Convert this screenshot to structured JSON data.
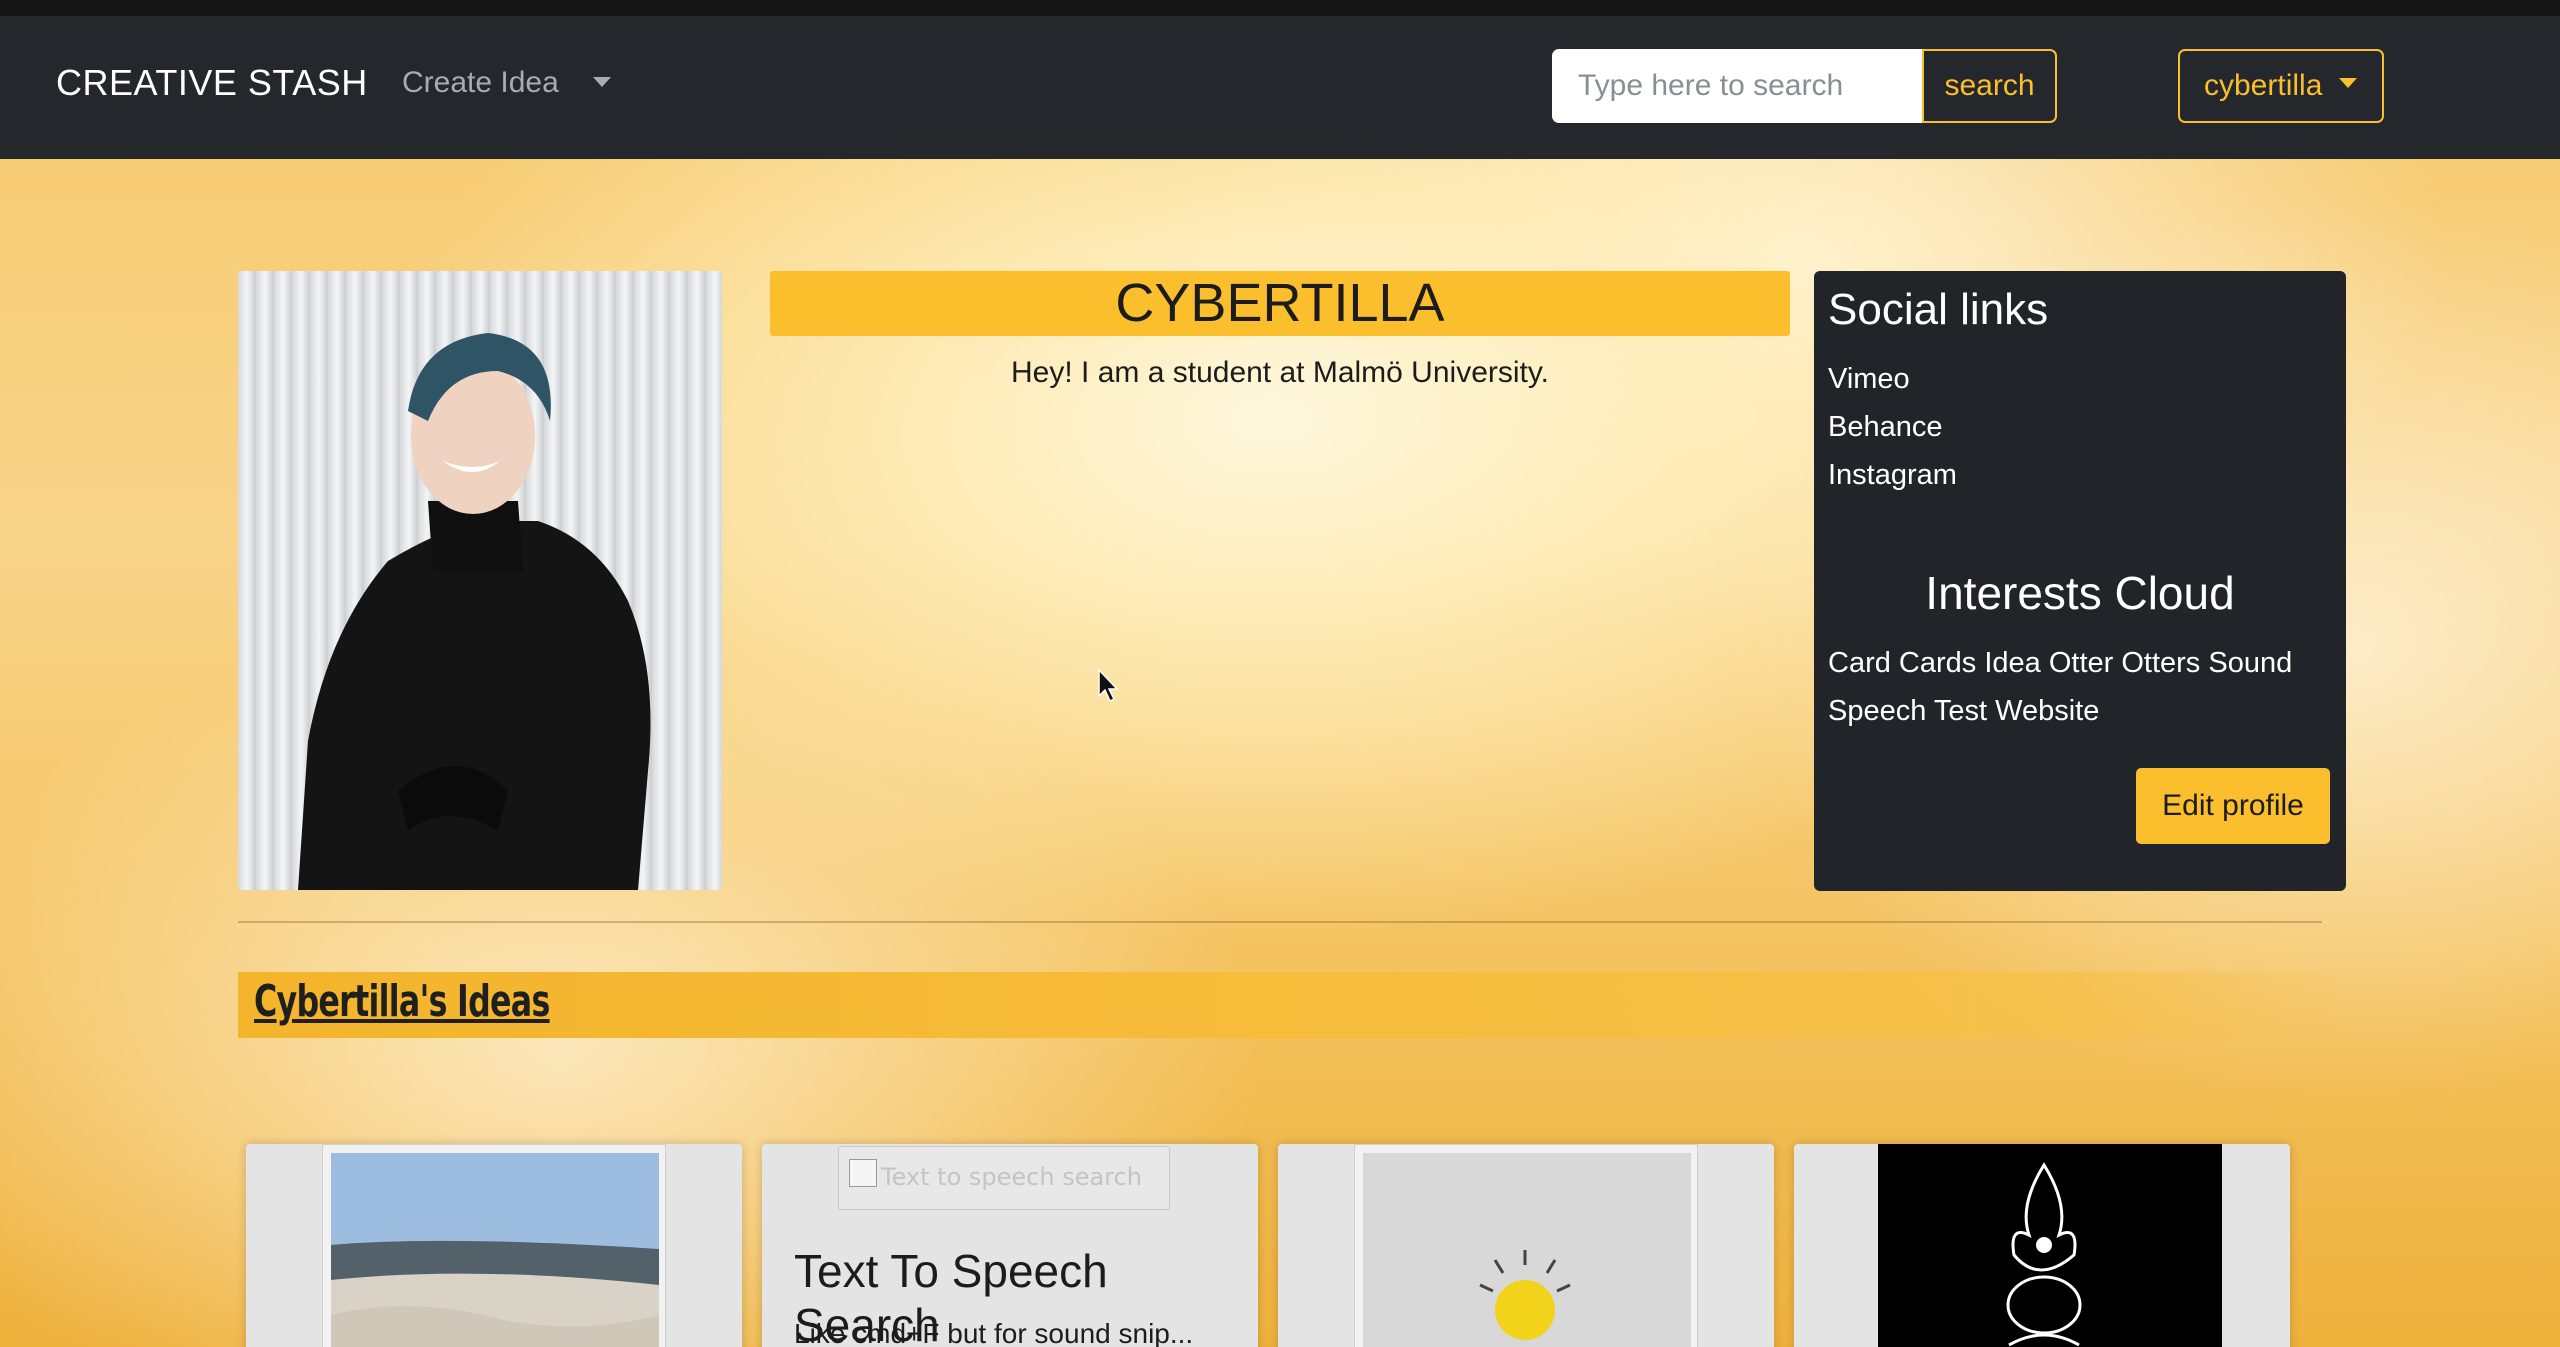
{
  "navbar": {
    "brand": "CREATIVE STASH",
    "create_idea_label": "Create Idea",
    "search_placeholder": "Type here to search",
    "search_button_label": "search",
    "user_menu_label": "cybertilla"
  },
  "profile": {
    "name": "CYBERTILLA",
    "bio": "Hey! I am a student at Malmö University.",
    "social_title": "Social links",
    "social_links": [
      "Vimeo",
      "Behance",
      "Instagram"
    ],
    "interests_title": "Interests Cloud",
    "interests": "Card Cards Idea Otter Otters Sound Speech Test Website",
    "edit_button_label": "Edit profile"
  },
  "ideas_section": {
    "title": "Cybertilla's Ideas",
    "cards": [
      {
        "image": "dunes-landscape-photo"
      },
      {
        "image_alt": "Text to speech search",
        "title": "Text To Speech Search",
        "description": "Like cmd+F but for sound snip..."
      },
      {
        "image": "crumpled-paper-lightbulb-photo"
      },
      {
        "image": "flame-creature-drawing"
      }
    ]
  },
  "colors": {
    "accent": "#fbbf2e",
    "navbar": "#24272b",
    "panel": "#212428"
  }
}
